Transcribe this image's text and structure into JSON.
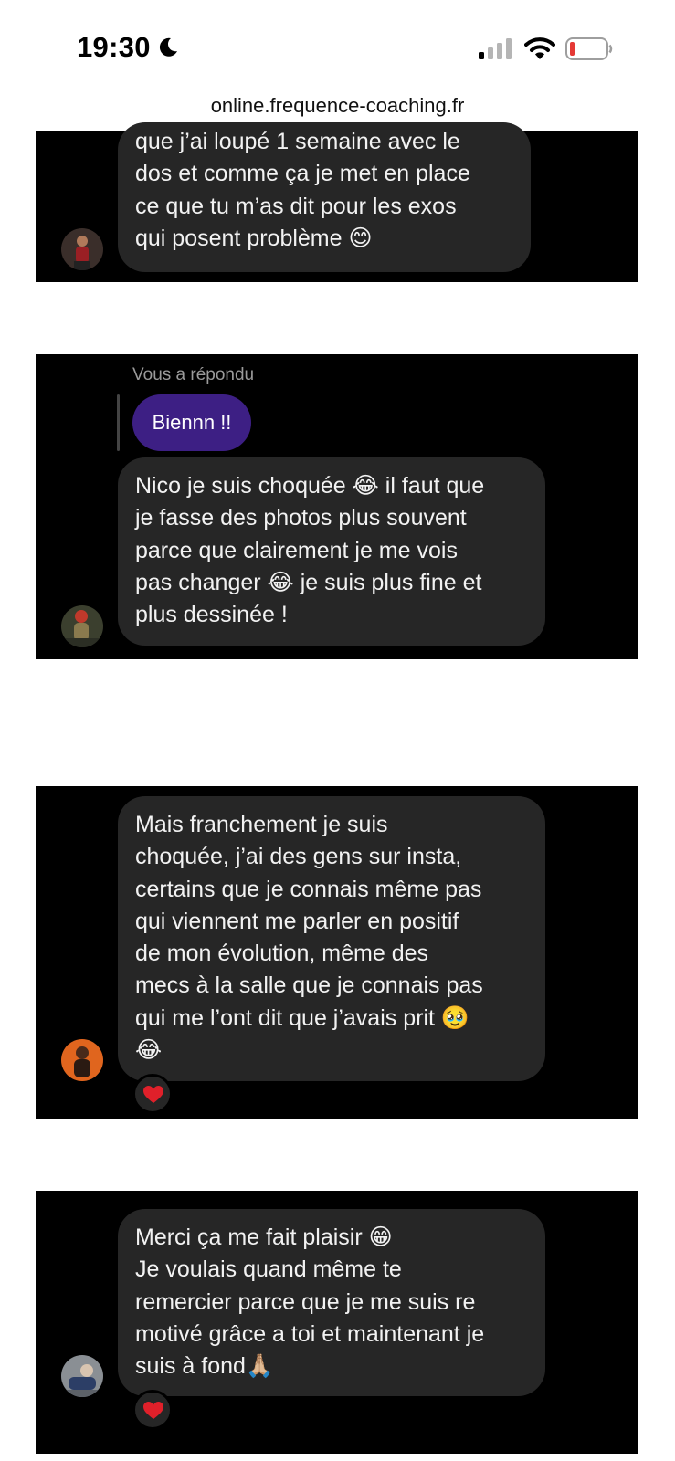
{
  "status_bar": {
    "time": "19:30",
    "icons": [
      "moon-icon",
      "cellular-signal-icon",
      "wifi-icon",
      "battery-low-icon"
    ],
    "battery_color": "#e53935"
  },
  "browser": {
    "url": "online.frequence-coaching.fr"
  },
  "colors": {
    "panel_bg": "#000000",
    "bubble_bg": "#262626",
    "reply_pill": "#3d1f84",
    "reaction_heart": "#e0202a"
  },
  "conversations": [
    {
      "message": {
        "lines": [
          "que j’ai loupé 1 semaine avec le",
          "dos et comme ça je met en place",
          "ce que tu m’as dit pour les exos",
          "qui posent problème 😊"
        ]
      }
    },
    {
      "reply_label": "Vous a répondu",
      "reply_text": "Biennn !!",
      "message": {
        "lines": [
          "Nico je suis choquée 😂 il faut que",
          "je fasse des photos plus souvent",
          "parce que clairement je me vois",
          "pas changer 😂 je suis plus fine et",
          "plus dessinée !"
        ]
      }
    },
    {
      "message": {
        "lines": [
          "Mais franchement je suis",
          "choquée, j’ai des gens sur insta,",
          "certains que je connais même pas",
          "qui viennent me parler en positif",
          "de mon évolution, même des",
          "mecs à la salle que je connais pas",
          "qui me l’ont dit que j’avais prit 🥹",
          "😂"
        ]
      },
      "reaction": "❤️"
    },
    {
      "message": {
        "lines": [
          "Merci ça me fait plaisir 😁",
          "Je voulais quand même te",
          "remercier parce que je me suis re",
          "motivé grâce a toi et maintenant je",
          "suis à fond🙏🏼"
        ]
      },
      "reaction": "❤️"
    }
  ]
}
